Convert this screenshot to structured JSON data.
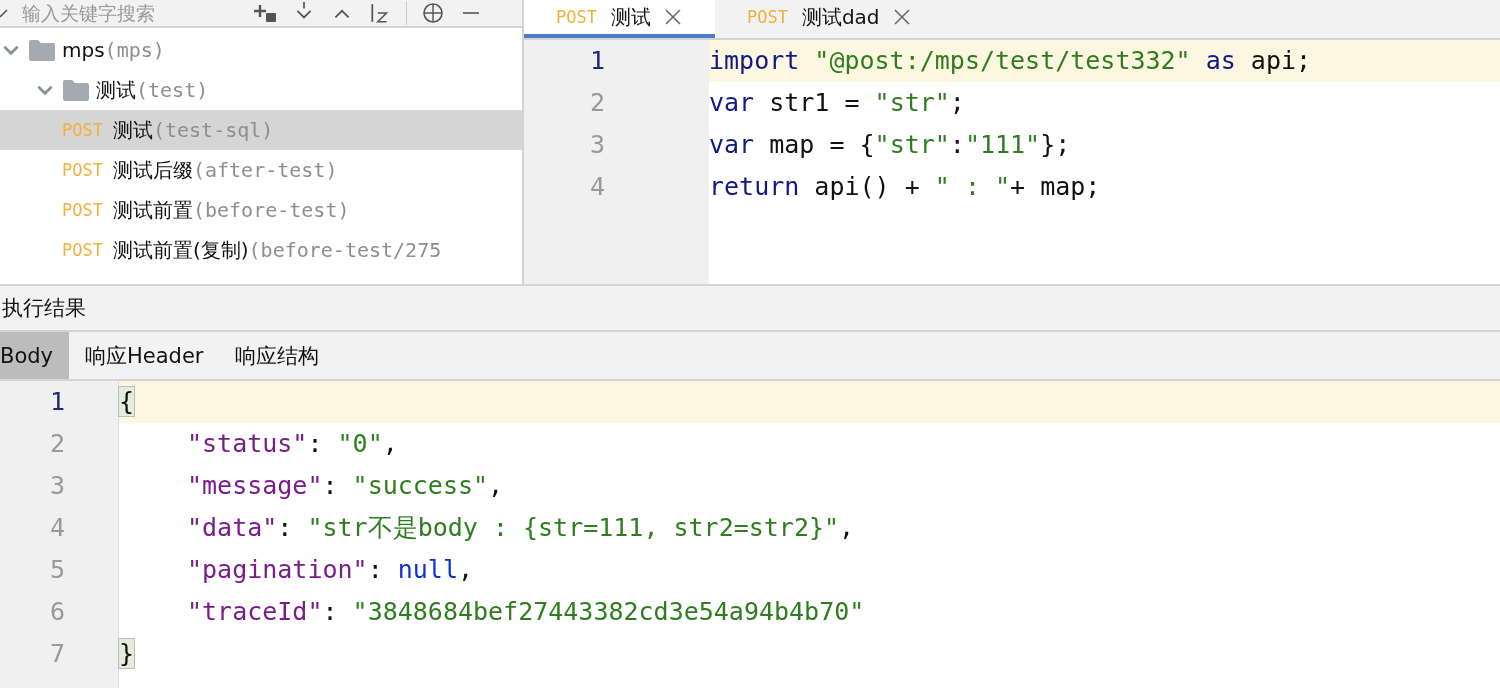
{
  "sidebar": {
    "search": {
      "placeholder": "输入关键字搜索"
    },
    "tree": [
      {
        "name": "mps",
        "path": "(mps)",
        "kind": "folder",
        "expanded": true,
        "selected": false,
        "children": [
          {
            "name": "测试",
            "path": "(test)",
            "kind": "folder",
            "expanded": true,
            "selected": false,
            "children": [
              {
                "method": "POST",
                "name": "测试",
                "path": "(test-sql)",
                "kind": "api",
                "selected": true
              },
              {
                "method": "POST",
                "name": "测试后缀",
                "path": "(after-test)",
                "kind": "api",
                "selected": false
              },
              {
                "method": "POST",
                "name": "测试前置",
                "path": "(before-test)",
                "kind": "api",
                "selected": false
              },
              {
                "method": "POST",
                "name": "测试前置(复制)",
                "path": "(before-test/275",
                "kind": "api",
                "selected": false
              }
            ]
          }
        ]
      }
    ]
  },
  "editor": {
    "tabs": [
      {
        "method": "POST",
        "label": "测试",
        "selected": true
      },
      {
        "method": "POST",
        "label": "测试dad",
        "selected": false
      }
    ],
    "lines": [
      {
        "number": "1",
        "current": true,
        "tokens": [
          {
            "kind": "keyword",
            "text": "import"
          },
          {
            "kind": "string",
            "text": " \"@post:/mps/test/test332\" "
          },
          {
            "kind": "keyword",
            "text": "as"
          },
          {
            "kind": "plain",
            "text": " api;"
          }
        ]
      },
      {
        "number": "2",
        "current": false,
        "tokens": [
          {
            "kind": "keyword",
            "text": "var"
          },
          {
            "kind": "plain",
            "text": " str1 = "
          },
          {
            "kind": "string",
            "text": "\"str\""
          },
          {
            "kind": "plain",
            "text": ";"
          }
        ]
      },
      {
        "number": "3",
        "current": false,
        "tokens": [
          {
            "kind": "keyword",
            "text": "var"
          },
          {
            "kind": "plain",
            "text": " map = {"
          },
          {
            "kind": "string",
            "text": "\"str\""
          },
          {
            "kind": "plain",
            "text": ":"
          },
          {
            "kind": "string",
            "text": "\"111\""
          },
          {
            "kind": "plain",
            "text": "};"
          }
        ]
      },
      {
        "number": "4",
        "current": false,
        "tokens": [
          {
            "kind": "keyword",
            "text": "return"
          },
          {
            "kind": "plain",
            "text": " api() + "
          },
          {
            "kind": "string",
            "text": "\" : \""
          },
          {
            "kind": "plain",
            "text": "+ map;"
          }
        ]
      }
    ]
  },
  "result": {
    "title": "执行结果",
    "tabs": [
      {
        "label": "Body",
        "selected": true
      },
      {
        "label": "响应Header",
        "selected": false
      },
      {
        "label": "响应结构",
        "selected": false
      }
    ],
    "lines": [
      {
        "number": "1",
        "current": true,
        "tokens": [
          {
            "kind": "brace",
            "text": "{"
          }
        ]
      },
      {
        "number": "2",
        "current": false,
        "tokens": [
          {
            "kind": "key",
            "text": "\"status\""
          },
          {
            "kind": "plain",
            "text": ": "
          },
          {
            "kind": "string",
            "text": "\"0\""
          },
          {
            "kind": "plain",
            "text": ","
          }
        ]
      },
      {
        "number": "3",
        "current": false,
        "tokens": [
          {
            "kind": "key",
            "text": "\"message\""
          },
          {
            "kind": "plain",
            "text": ": "
          },
          {
            "kind": "string",
            "text": "\"success\""
          },
          {
            "kind": "plain",
            "text": ","
          }
        ]
      },
      {
        "number": "4",
        "current": false,
        "tokens": [
          {
            "kind": "key",
            "text": "\"data\""
          },
          {
            "kind": "plain",
            "text": ": "
          },
          {
            "kind": "string",
            "text": "\"str不是body : {str=111, str2=str2}\""
          },
          {
            "kind": "plain",
            "text": ","
          }
        ]
      },
      {
        "number": "5",
        "current": false,
        "tokens": [
          {
            "kind": "key",
            "text": "\"pagination\""
          },
          {
            "kind": "plain",
            "text": ": "
          },
          {
            "kind": "literal",
            "text": "null"
          },
          {
            "kind": "plain",
            "text": ","
          }
        ]
      },
      {
        "number": "6",
        "current": false,
        "tokens": [
          {
            "kind": "key",
            "text": "\"traceId\""
          },
          {
            "kind": "plain",
            "text": ": "
          },
          {
            "kind": "string",
            "text": "\"3848684bef27443382cd3e54a94b4b70\""
          }
        ]
      },
      {
        "number": "7",
        "current": false,
        "tokens": [
          {
            "kind": "brace",
            "text": "}"
          }
        ]
      }
    ]
  }
}
